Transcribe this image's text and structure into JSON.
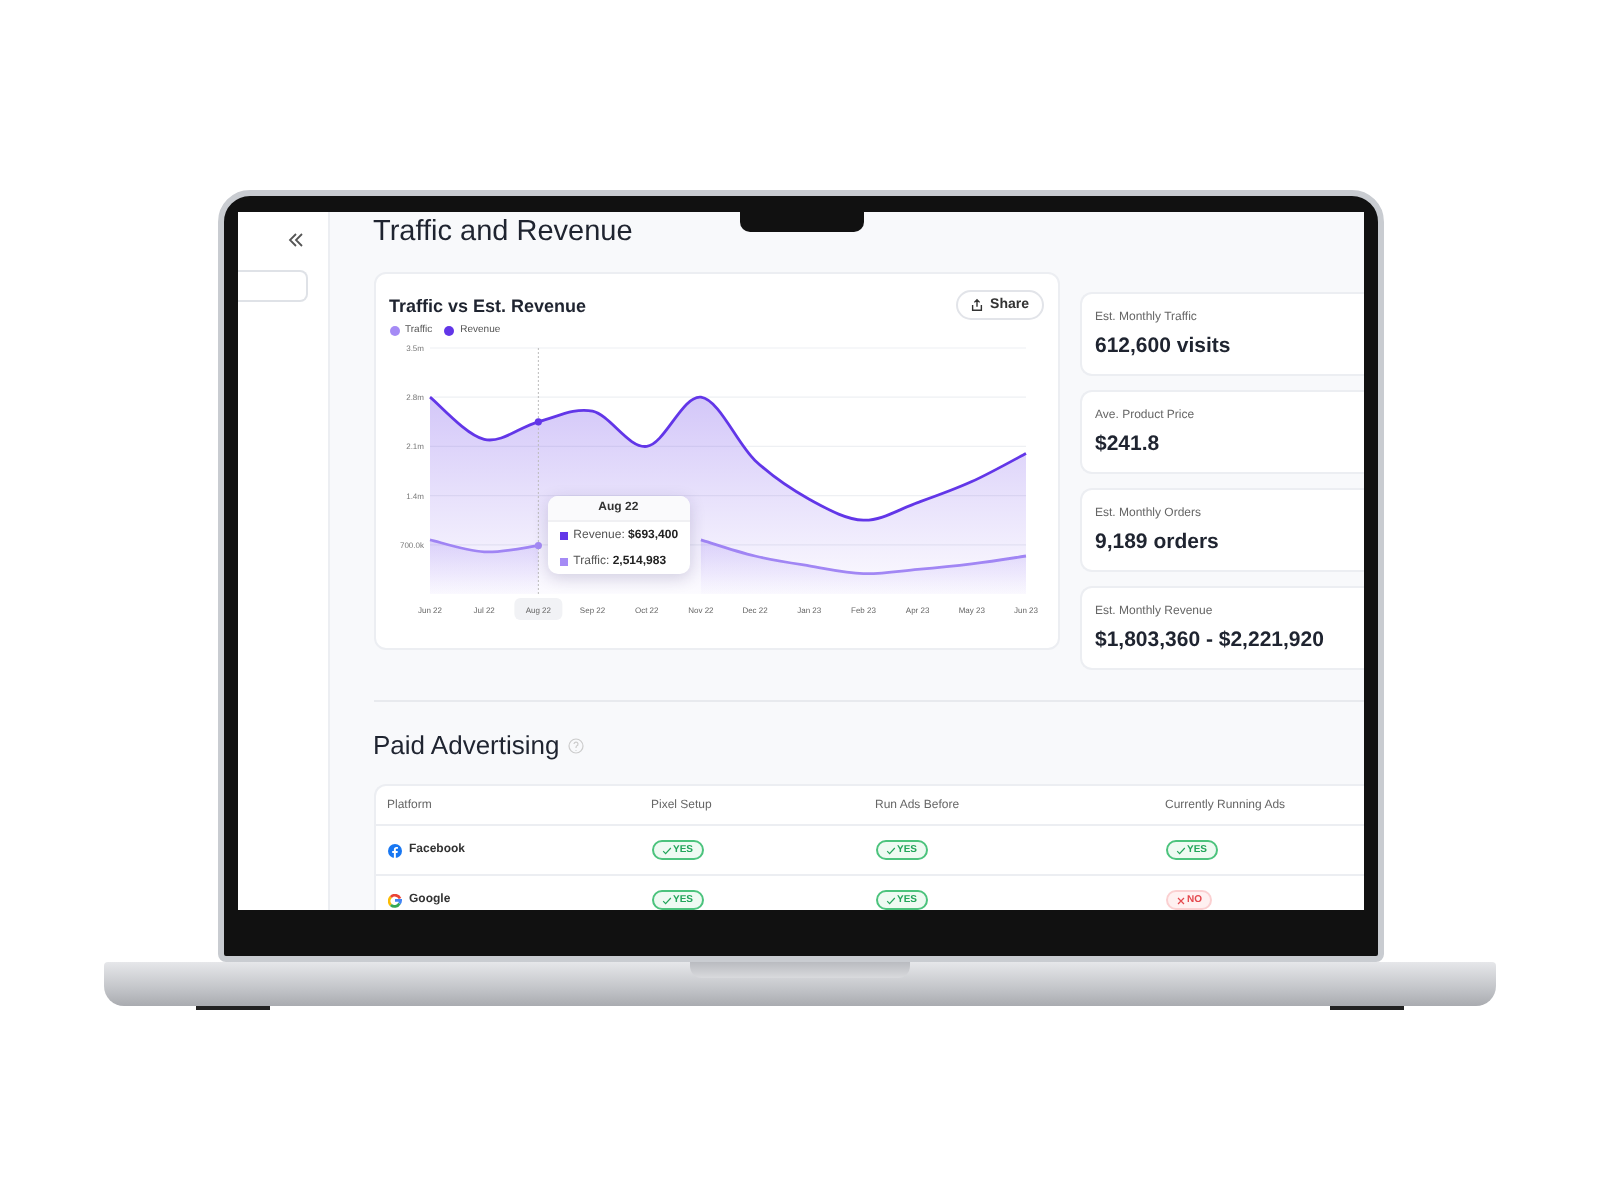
{
  "sidebar": {
    "collapse": true
  },
  "section_title": "Traffic and Revenue",
  "chart_card": {
    "title": "Traffic vs Est. Revenue",
    "share_button": "Share",
    "chart_data": {
      "type": "area",
      "grid": true,
      "categories": [
        "Jun 22",
        "Jul 22",
        "Aug 22",
        "Sep 22",
        "Oct 22",
        "Nov 22",
        "Dec 22",
        "Jan 23",
        "Feb 23",
        "Apr 23",
        "May 23",
        "Jun 23"
      ],
      "ylim": [
        0,
        3500000
      ],
      "yticks": [
        {
          "value": 700000,
          "label": "700.0k"
        },
        {
          "value": 1400000,
          "label": "1.4m"
        },
        {
          "value": 2100000,
          "label": "2.1m"
        },
        {
          "value": 2800000,
          "label": "2.8m"
        },
        {
          "value": 3500000,
          "label": "3.5m"
        }
      ],
      "series": [
        {
          "name": "Traffic",
          "color": "#a58bf5",
          "values": [
            770000,
            600000,
            690000,
            null,
            null,
            770000,
            540000,
            400000,
            290000,
            350000,
            430000,
            540000
          ]
        },
        {
          "name": "Revenue",
          "color": "#6236e8",
          "values": [
            2800000,
            2200000,
            2450000,
            2600000,
            2100000,
            2800000,
            1900000,
            1350000,
            1050000,
            1300000,
            1600000,
            2000000
          ]
        }
      ]
    },
    "tooltip": {
      "title": "Aug 22",
      "rows": [
        {
          "text": "Revenue: **$693,400**",
          "color": "#6236e8"
        },
        {
          "text": "Traffic: **2,514,983**",
          "color": "#a58bf5"
        }
      ]
    }
  },
  "stats": [
    {
      "label": "Est. Monthly Traffic",
      "value": "612,600 visits"
    },
    {
      "label": "Ave. Product Price",
      "value": "$241.8"
    },
    {
      "label": "Est. Monthly Orders",
      "value": "9,189 orders"
    },
    {
      "label": "Est. Monthly Revenue",
      "value": "$1,803,360 - $2,221,920"
    }
  ],
  "paid_advertising": {
    "title": "Paid Advertising",
    "columns": [
      "Platform",
      "Pixel Setup",
      "Run Ads Before",
      "Currently Running Ads"
    ],
    "rows": [
      {
        "cells": [
          {
            "kind": "circled",
            "text": "Facebook"
          },
          {
            "kind": "status",
            "text": "YES",
            "ok": true
          },
          {
            "kind": "status",
            "text": "YES",
            "ok": true
          },
          {
            "kind": "status",
            "text": "YES",
            "ok": true
          }
        ]
      },
      {
        "cells": [
          {
            "kind": "ringed",
            "text": "Google"
          },
          {
            "kind": "status",
            "text": "YES",
            "ok": true
          },
          {
            "kind": "status",
            "text": "YES",
            "ok": true
          },
          {
            "kind": "status",
            "text": "NO",
            "ok": false
          }
        ]
      }
    ]
  }
}
